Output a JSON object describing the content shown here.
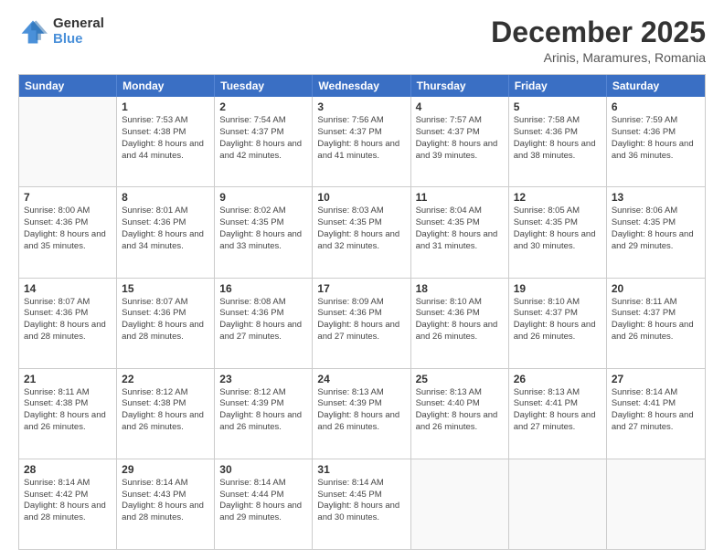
{
  "logo": {
    "general": "General",
    "blue": "Blue"
  },
  "header": {
    "month": "December 2025",
    "location": "Arinis, Maramures, Romania"
  },
  "weekdays": [
    "Sunday",
    "Monday",
    "Tuesday",
    "Wednesday",
    "Thursday",
    "Friday",
    "Saturday"
  ],
  "weeks": [
    [
      {
        "day": "",
        "sunrise": "",
        "sunset": "",
        "daylight": ""
      },
      {
        "day": "1",
        "sunrise": "Sunrise: 7:53 AM",
        "sunset": "Sunset: 4:38 PM",
        "daylight": "Daylight: 8 hours and 44 minutes."
      },
      {
        "day": "2",
        "sunrise": "Sunrise: 7:54 AM",
        "sunset": "Sunset: 4:37 PM",
        "daylight": "Daylight: 8 hours and 42 minutes."
      },
      {
        "day": "3",
        "sunrise": "Sunrise: 7:56 AM",
        "sunset": "Sunset: 4:37 PM",
        "daylight": "Daylight: 8 hours and 41 minutes."
      },
      {
        "day": "4",
        "sunrise": "Sunrise: 7:57 AM",
        "sunset": "Sunset: 4:37 PM",
        "daylight": "Daylight: 8 hours and 39 minutes."
      },
      {
        "day": "5",
        "sunrise": "Sunrise: 7:58 AM",
        "sunset": "Sunset: 4:36 PM",
        "daylight": "Daylight: 8 hours and 38 minutes."
      },
      {
        "day": "6",
        "sunrise": "Sunrise: 7:59 AM",
        "sunset": "Sunset: 4:36 PM",
        "daylight": "Daylight: 8 hours and 36 minutes."
      }
    ],
    [
      {
        "day": "7",
        "sunrise": "Sunrise: 8:00 AM",
        "sunset": "Sunset: 4:36 PM",
        "daylight": "Daylight: 8 hours and 35 minutes."
      },
      {
        "day": "8",
        "sunrise": "Sunrise: 8:01 AM",
        "sunset": "Sunset: 4:36 PM",
        "daylight": "Daylight: 8 hours and 34 minutes."
      },
      {
        "day": "9",
        "sunrise": "Sunrise: 8:02 AM",
        "sunset": "Sunset: 4:35 PM",
        "daylight": "Daylight: 8 hours and 33 minutes."
      },
      {
        "day": "10",
        "sunrise": "Sunrise: 8:03 AM",
        "sunset": "Sunset: 4:35 PM",
        "daylight": "Daylight: 8 hours and 32 minutes."
      },
      {
        "day": "11",
        "sunrise": "Sunrise: 8:04 AM",
        "sunset": "Sunset: 4:35 PM",
        "daylight": "Daylight: 8 hours and 31 minutes."
      },
      {
        "day": "12",
        "sunrise": "Sunrise: 8:05 AM",
        "sunset": "Sunset: 4:35 PM",
        "daylight": "Daylight: 8 hours and 30 minutes."
      },
      {
        "day": "13",
        "sunrise": "Sunrise: 8:06 AM",
        "sunset": "Sunset: 4:35 PM",
        "daylight": "Daylight: 8 hours and 29 minutes."
      }
    ],
    [
      {
        "day": "14",
        "sunrise": "Sunrise: 8:07 AM",
        "sunset": "Sunset: 4:36 PM",
        "daylight": "Daylight: 8 hours and 28 minutes."
      },
      {
        "day": "15",
        "sunrise": "Sunrise: 8:07 AM",
        "sunset": "Sunset: 4:36 PM",
        "daylight": "Daylight: 8 hours and 28 minutes."
      },
      {
        "day": "16",
        "sunrise": "Sunrise: 8:08 AM",
        "sunset": "Sunset: 4:36 PM",
        "daylight": "Daylight: 8 hours and 27 minutes."
      },
      {
        "day": "17",
        "sunrise": "Sunrise: 8:09 AM",
        "sunset": "Sunset: 4:36 PM",
        "daylight": "Daylight: 8 hours and 27 minutes."
      },
      {
        "day": "18",
        "sunrise": "Sunrise: 8:10 AM",
        "sunset": "Sunset: 4:36 PM",
        "daylight": "Daylight: 8 hours and 26 minutes."
      },
      {
        "day": "19",
        "sunrise": "Sunrise: 8:10 AM",
        "sunset": "Sunset: 4:37 PM",
        "daylight": "Daylight: 8 hours and 26 minutes."
      },
      {
        "day": "20",
        "sunrise": "Sunrise: 8:11 AM",
        "sunset": "Sunset: 4:37 PM",
        "daylight": "Daylight: 8 hours and 26 minutes."
      }
    ],
    [
      {
        "day": "21",
        "sunrise": "Sunrise: 8:11 AM",
        "sunset": "Sunset: 4:38 PM",
        "daylight": "Daylight: 8 hours and 26 minutes."
      },
      {
        "day": "22",
        "sunrise": "Sunrise: 8:12 AM",
        "sunset": "Sunset: 4:38 PM",
        "daylight": "Daylight: 8 hours and 26 minutes."
      },
      {
        "day": "23",
        "sunrise": "Sunrise: 8:12 AM",
        "sunset": "Sunset: 4:39 PM",
        "daylight": "Daylight: 8 hours and 26 minutes."
      },
      {
        "day": "24",
        "sunrise": "Sunrise: 8:13 AM",
        "sunset": "Sunset: 4:39 PM",
        "daylight": "Daylight: 8 hours and 26 minutes."
      },
      {
        "day": "25",
        "sunrise": "Sunrise: 8:13 AM",
        "sunset": "Sunset: 4:40 PM",
        "daylight": "Daylight: 8 hours and 26 minutes."
      },
      {
        "day": "26",
        "sunrise": "Sunrise: 8:13 AM",
        "sunset": "Sunset: 4:41 PM",
        "daylight": "Daylight: 8 hours and 27 minutes."
      },
      {
        "day": "27",
        "sunrise": "Sunrise: 8:14 AM",
        "sunset": "Sunset: 4:41 PM",
        "daylight": "Daylight: 8 hours and 27 minutes."
      }
    ],
    [
      {
        "day": "28",
        "sunrise": "Sunrise: 8:14 AM",
        "sunset": "Sunset: 4:42 PM",
        "daylight": "Daylight: 8 hours and 28 minutes."
      },
      {
        "day": "29",
        "sunrise": "Sunrise: 8:14 AM",
        "sunset": "Sunset: 4:43 PM",
        "daylight": "Daylight: 8 hours and 28 minutes."
      },
      {
        "day": "30",
        "sunrise": "Sunrise: 8:14 AM",
        "sunset": "Sunset: 4:44 PM",
        "daylight": "Daylight: 8 hours and 29 minutes."
      },
      {
        "day": "31",
        "sunrise": "Sunrise: 8:14 AM",
        "sunset": "Sunset: 4:45 PM",
        "daylight": "Daylight: 8 hours and 30 minutes."
      },
      {
        "day": "",
        "sunrise": "",
        "sunset": "",
        "daylight": ""
      },
      {
        "day": "",
        "sunrise": "",
        "sunset": "",
        "daylight": ""
      },
      {
        "day": "",
        "sunrise": "",
        "sunset": "",
        "daylight": ""
      }
    ]
  ]
}
